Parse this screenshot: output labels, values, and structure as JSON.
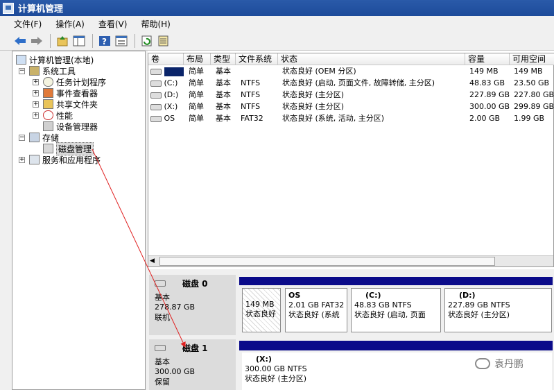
{
  "window": {
    "title": "计算机管理"
  },
  "menu": [
    "文件(F)",
    "操作(A)",
    "查看(V)",
    "帮助(H)"
  ],
  "toolbar_icons": [
    "back-icon",
    "forward-icon",
    "up-icon",
    "show-hide-tree-icon",
    "help-icon",
    "properties-icon",
    "refresh-icon",
    "export-icon"
  ],
  "tree": {
    "root": "计算机管理(本地)",
    "system_tools": "系统工具",
    "task_scheduler": "任务计划程序",
    "event_viewer": "事件查看器",
    "shared_folders": "共享文件夹",
    "performance": "性能",
    "device_manager": "设备管理器",
    "storage": "存储",
    "disk_management": "磁盘管理",
    "services": "服务和应用程序"
  },
  "volume_table": {
    "columns": [
      "卷",
      "布局",
      "类型",
      "文件系统",
      "状态",
      "容量",
      "可用空间"
    ],
    "rows": [
      {
        "vol": "",
        "layout": "简单",
        "type": "基本",
        "fs": "",
        "status": "状态良好 (OEM 分区)",
        "capacity": "149 MB",
        "free": "149 MB"
      },
      {
        "vol": "(C:)",
        "layout": "简单",
        "type": "基本",
        "fs": "NTFS",
        "status": "状态良好 (启动, 页面文件, 故障转储, 主分区)",
        "capacity": "48.83 GB",
        "free": "23.50 GB"
      },
      {
        "vol": "(D:)",
        "layout": "简单",
        "type": "基本",
        "fs": "NTFS",
        "status": "状态良好 (主分区)",
        "capacity": "227.89 GB",
        "free": "227.80 GB"
      },
      {
        "vol": "(X:)",
        "layout": "简单",
        "type": "基本",
        "fs": "NTFS",
        "status": "状态良好 (主分区)",
        "capacity": "300.00 GB",
        "free": "299.89 GB"
      },
      {
        "vol": "OS",
        "layout": "简单",
        "type": "基本",
        "fs": "FAT32",
        "status": "状态良好 (系统, 活动, 主分区)",
        "capacity": "2.00 GB",
        "free": "1.99 GB"
      }
    ]
  },
  "disk0": {
    "name": "磁盘 0",
    "type": "基本",
    "size": "278.87 GB",
    "state": "联机",
    "partitions": [
      {
        "title": "",
        "size": "149 MB",
        "status": "状态良好"
      },
      {
        "title": "OS",
        "size": "2.01 GB FAT32",
        "status": "状态良好 (系统"
      },
      {
        "title": "(C:)",
        "size": "48.83 GB NTFS",
        "status": "状态良好 (启动, 页面"
      },
      {
        "title": "(D:)",
        "size": "227.89 GB NTFS",
        "status": "状态良好 (主分区)"
      }
    ]
  },
  "disk1": {
    "name": "磁盘 1",
    "type": "基本",
    "size": "300.00 GB",
    "state": "保留",
    "partitions": [
      {
        "title": "(X:)",
        "size": "300.00 GB NTFS",
        "status": "状态良好 (主分区)"
      }
    ]
  },
  "watermark": "袁丹鹏",
  "colors": {
    "title_bar": "#1d4b9a",
    "partition_bar": "#0b0b8a",
    "annotation_arrow": "#e02020"
  }
}
